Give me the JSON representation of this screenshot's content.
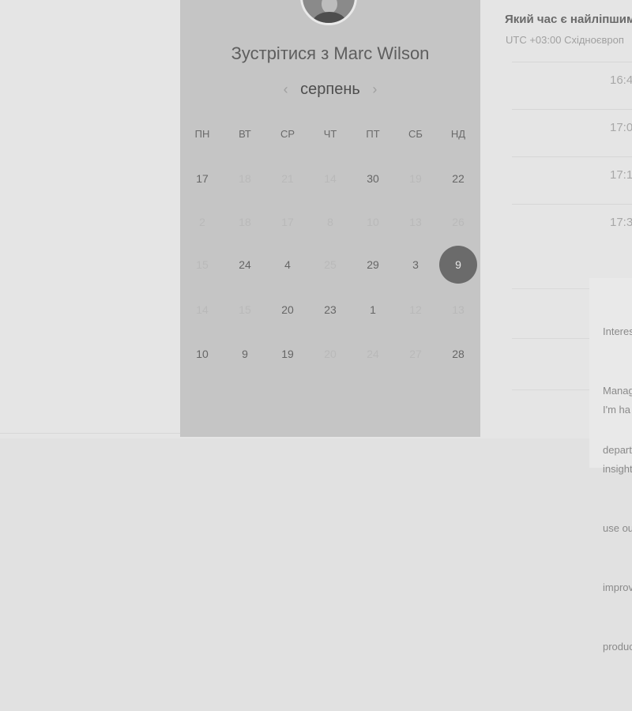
{
  "calendar": {
    "title": "Зустрітися з Marc Wilson",
    "month": "серпень",
    "prev_icon": "‹",
    "next_icon": "›",
    "weekdays": [
      "ПН",
      "ВТ",
      "СР",
      "ЧТ",
      "ПТ",
      "СБ",
      "НД"
    ],
    "weeks": [
      [
        {
          "d": "17",
          "dim": false
        },
        {
          "d": "18",
          "dim": true
        },
        {
          "d": "21",
          "dim": true
        },
        {
          "d": "14",
          "dim": true
        },
        {
          "d": "30",
          "dim": false
        },
        {
          "d": "19",
          "dim": true
        },
        {
          "d": "22",
          "dim": false
        }
      ],
      [
        {
          "d": "2",
          "dim": true
        },
        {
          "d": "18",
          "dim": true
        },
        {
          "d": "17",
          "dim": true
        },
        {
          "d": "8",
          "dim": true
        },
        {
          "d": "10",
          "dim": true
        },
        {
          "d": "13",
          "dim": true
        },
        {
          "d": "26",
          "dim": true
        }
      ],
      [
        {
          "d": "15",
          "dim": true
        },
        {
          "d": "24",
          "dim": false
        },
        {
          "d": "4",
          "dim": false
        },
        {
          "d": "25",
          "dim": true
        },
        {
          "d": "29",
          "dim": false
        },
        {
          "d": "3",
          "dim": false
        },
        {
          "d": "9",
          "dim": false,
          "selected": true
        }
      ],
      [
        {
          "d": "14",
          "dim": true
        },
        {
          "d": "15",
          "dim": true
        },
        {
          "d": "20",
          "dim": false
        },
        {
          "d": "23",
          "dim": false
        },
        {
          "d": "1",
          "dim": false
        },
        {
          "d": "12",
          "dim": true
        },
        {
          "d": "13",
          "dim": true
        }
      ],
      [
        {
          "d": "10",
          "dim": false
        },
        {
          "d": "9",
          "dim": false
        },
        {
          "d": "19",
          "dim": false
        },
        {
          "d": "20",
          "dim": true
        },
        {
          "d": "24",
          "dim": true
        },
        {
          "d": "27",
          "dim": true
        },
        {
          "d": "28",
          "dim": false
        }
      ]
    ]
  },
  "schedule": {
    "title": "Який час є найліпшим",
    "timezone": "UTC +03:00 Східноєвроп",
    "slots": [
      "16:4",
      "17:0",
      "17:1",
      "17:3"
    ]
  },
  "info": {
    "paragraph1": [
      "Interes",
      "Manag",
      "depart"
    ],
    "paragraph2": [
      "I'm ha",
      "insight",
      "use ou",
      "improv",
      "produc"
    ]
  }
}
